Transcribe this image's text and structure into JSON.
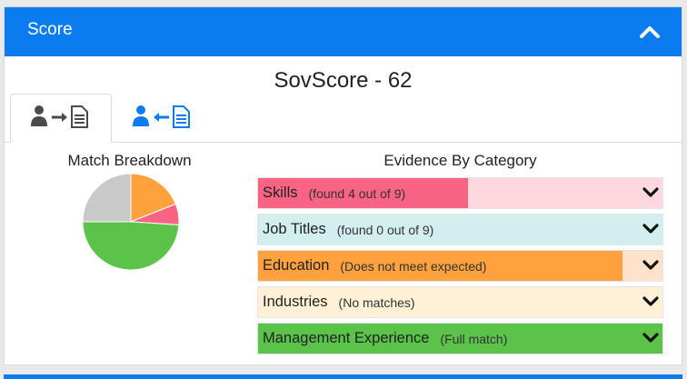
{
  "panel": {
    "title": "Score",
    "header_color": "#0b7cef",
    "collapse_icon": "chevron-up-icon"
  },
  "score_title": "SovScore - 62",
  "tabs": [
    {
      "icon": "person-to-document-icon",
      "active": true,
      "color": "#4a4a4a"
    },
    {
      "icon": "person-from-document-icon",
      "active": false,
      "color": "#0b7cef"
    }
  ],
  "match_breakdown": {
    "title": "Match Breakdown"
  },
  "chart_data": {
    "type": "pie",
    "slices": [
      {
        "category": "Education",
        "value": 19,
        "color": "#ffa23e"
      },
      {
        "category": "Skills",
        "value": 7,
        "color": "#fa6484"
      },
      {
        "category": "Management Experience",
        "value": 49,
        "color": "#5bc34a"
      },
      {
        "category": "Other",
        "value": 25,
        "color": "#c9c9c9"
      }
    ]
  },
  "evidence": {
    "title": "Evidence By Category",
    "expand_icon": "chevron-down-icon",
    "categories": [
      {
        "name": "Skills",
        "detail": "(found 4 out of 9)",
        "fill": 0.52,
        "fill_color": "#fa6484",
        "bg_color": "#ffd7df"
      },
      {
        "name": "Job Titles",
        "detail": "(found 0 out of 9)",
        "fill": 0.0,
        "fill_color": "#48bdbd",
        "bg_color": "#d3eeee"
      },
      {
        "name": "Education",
        "detail": "(Does not meet expected)",
        "fill": 0.9,
        "fill_color": "#ffa23e",
        "bg_color": "#ffe2cc"
      },
      {
        "name": "Industries",
        "detail": "(No matches)",
        "fill": 0.0,
        "fill_color": "#ffcf73",
        "bg_color": "#fff0d6"
      },
      {
        "name": "Management Experience",
        "detail": "(Full match)",
        "fill": 1.0,
        "fill_color": "#5bc34a",
        "bg_color": "#d6f0cf"
      }
    ]
  }
}
